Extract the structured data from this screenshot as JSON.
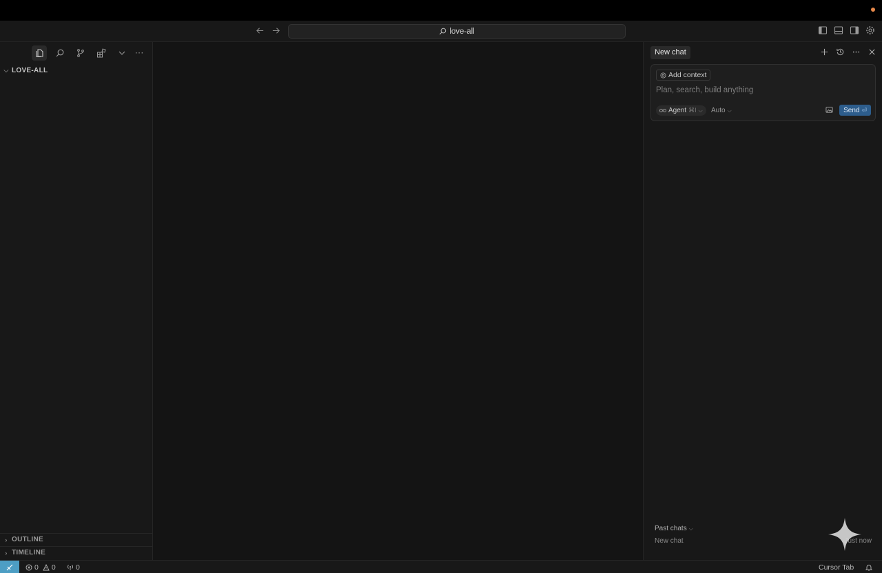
{
  "titlebar": {
    "back_icon": "arrow-left-icon",
    "forward_icon": "arrow-right-icon",
    "search_text": "love-all",
    "right_icons": [
      "toggle-primary-sidebar-icon",
      "toggle-panel-icon",
      "toggle-secondary-sidebar-icon",
      "settings-gear-icon"
    ]
  },
  "sidebar": {
    "tools": [
      "explorer-icon",
      "search-icon",
      "source-control-icon",
      "extensions-icon",
      "chevron-down-icon"
    ],
    "folder_name": "LOVE-ALL",
    "sections": [
      {
        "label": "OUTLINE"
      },
      {
        "label": "TIMELINE"
      }
    ]
  },
  "chat": {
    "tab_title": "New chat",
    "actions": [
      "plus-icon",
      "history-icon",
      "more-icon",
      "close-icon"
    ],
    "add_context": "Add context",
    "placeholder": "Plan, search, build anything",
    "mode": "Agent",
    "mode_shortcut": "⌘I",
    "model": "Auto",
    "send": "Send",
    "send_shortcut": "⏎",
    "past_chats_label": "Past chats",
    "past_items": [
      {
        "title": "New chat",
        "time": "Just now"
      }
    ]
  },
  "statusbar": {
    "errors": "0",
    "warnings": "0",
    "ports": "0",
    "cursor_tab": "Cursor Tab"
  },
  "colors": {
    "accent": "#2d5d8c",
    "remote": "#4d9ec4",
    "background": "#141414",
    "notification_dot": "#e8894a"
  }
}
